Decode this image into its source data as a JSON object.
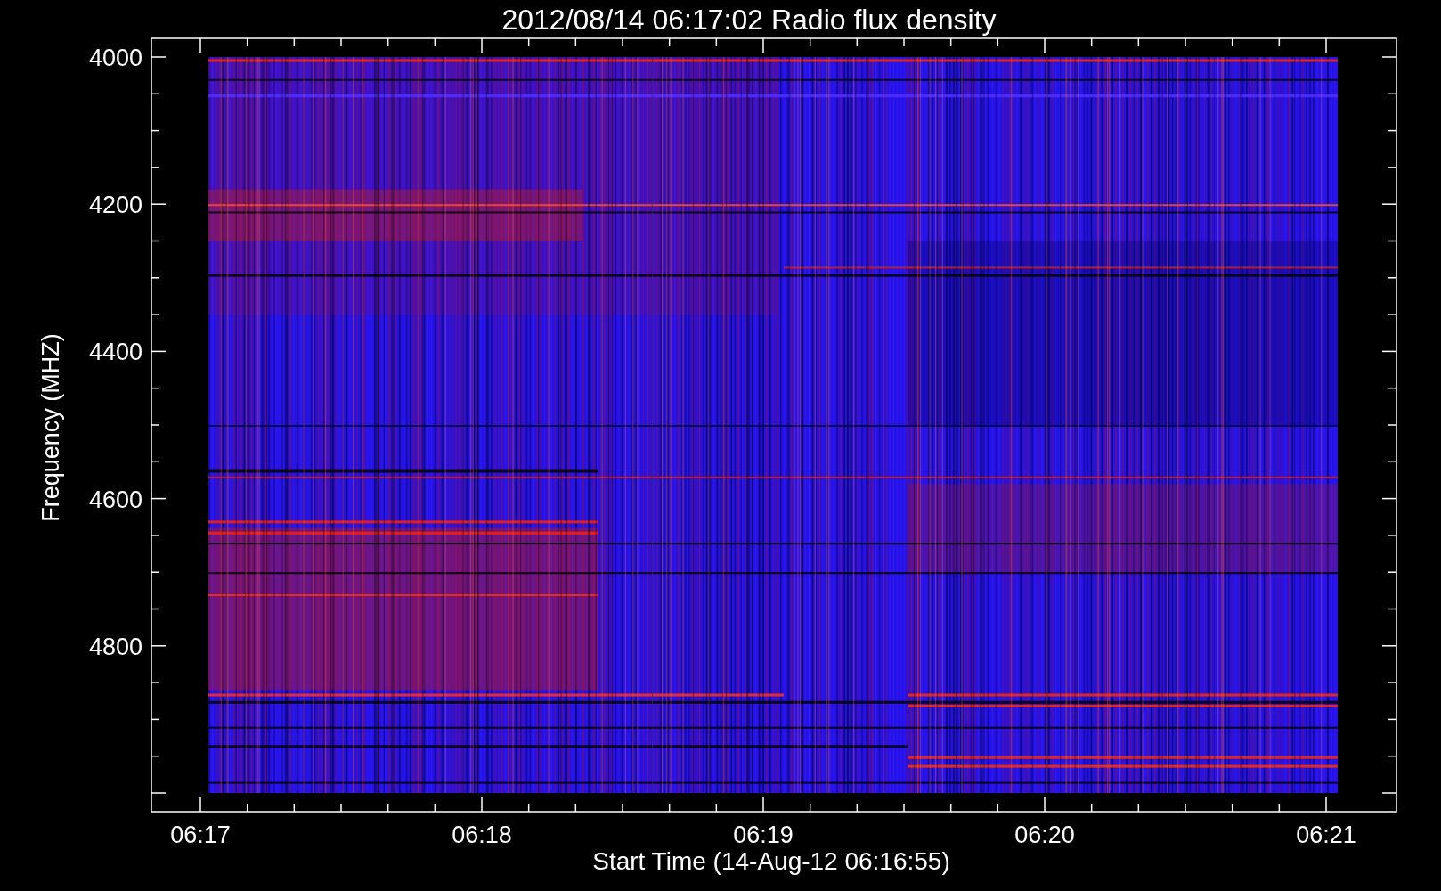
{
  "plot": {
    "title": "2012/08/14 06:17:02 Radio flux density",
    "y_axis": {
      "label": "Frequency (MHZ)",
      "ticks": [
        "4000",
        "4200",
        "4400",
        "4600",
        "4800"
      ]
    },
    "x_axis": {
      "label": "Start Time (14-Aug-12 06:16:55)",
      "ticks": [
        "06:17",
        "06:18",
        "06:19",
        "06:20",
        "06:21"
      ]
    }
  }
}
